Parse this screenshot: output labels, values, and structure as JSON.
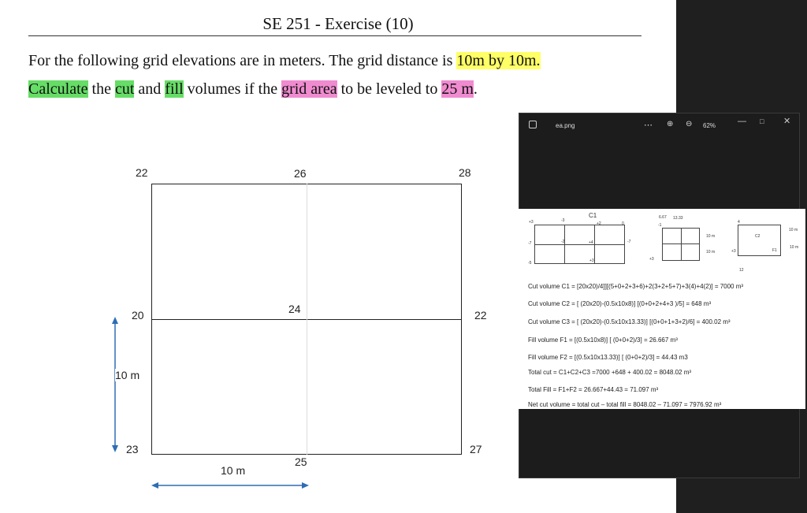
{
  "slide": {
    "title": "SE 251 - Exercise (10)",
    "problem": {
      "line1_prefix": "For the following grid elevations are in meters. The grid distance is ",
      "line1_highlight": "10m by 10m.",
      "line2_calculate": "Calculate",
      "line2_the": " the ",
      "line2_cut": "cut",
      "line2_and": " and ",
      "line2_fill": "fill",
      "line2_mid": " volumes if the ",
      "line2_grid_area": "grid area",
      "line2_leveled": " to be leveled to ",
      "line2_level": "25 m",
      "line2_end": "."
    },
    "grid": {
      "elevations": {
        "top_left": "22",
        "top_mid": "26",
        "top_right": "28",
        "mid_left": "20",
        "center": "24",
        "mid_right": "22",
        "bottom_left": "23",
        "bottom_mid": "25",
        "bottom_right": "27"
      },
      "vertical_dim": "10 m",
      "horizontal_dim": "10 m"
    }
  },
  "viewer": {
    "file_name": "ea.png",
    "zoom": "62%",
    "more": "⋯",
    "zoom_in": "⊕",
    "zoom_out": "⊖",
    "minimize": "—",
    "maximize": "□",
    "close": "✕",
    "image": {
      "c1_label": "C1",
      "c2_label": "C2",
      "f1_label": "F1",
      "dim_1333": "13.33",
      "dim_667": "6.67",
      "dim_10m_a": "10 m",
      "dim_10m_b": "10 m",
      "dim_10m_c": "10 m",
      "dim_10m_d": "10 m",
      "dim_12": "12",
      "g": {
        "p3": "+3",
        "m3": "-3",
        "p2": "+2",
        "zero": "0",
        "m7": "-7",
        "m2": "-2",
        "p4": "+4",
        "p7": "-7",
        "p6": "-5",
        "m1": "-1",
        "p3b": "+3",
        "m4": "4"
      }
    },
    "solution": [
      "Cut volume C1 = [20x20)/4]][(5+0+2+3+6)+2(3+2+5+7)+3(4)+4(2)] = 7000 m³",
      "Cut volume C2 = [ (20x20)-(0.5x10x8)] [(0+0+2+4+3 )/5] = 648 m³",
      "Cut volume C3 = [ (20x20)-(0.5x10x13.33)] [(0+0+1+3+2)/6] = 400.02 m³",
      "Fill volume  F1 = [(0.5x10x8)] [ (0+0+2)/3] = 26.667 m³",
      "Fill volume  F2 = [(0.5x10x13.33)] [ (0+0+2)/3] = 44.43 m3",
      "Total cut = C1+C2+C3 =7000 +648 + 400.02 = 8048.02 m³",
      "Total Fill = F1+F2 = 26.667+44.43 = 71.097 m³",
      "Net cut volume = total cut – total fill = 8048.02 – 71.097 = 7976.92 m³"
    ]
  },
  "colors": {
    "highlight_yellow": "#ffff66",
    "highlight_green": "#66dd66",
    "highlight_pink": "#f08bd0",
    "arrow_blue": "#2e6db4"
  }
}
